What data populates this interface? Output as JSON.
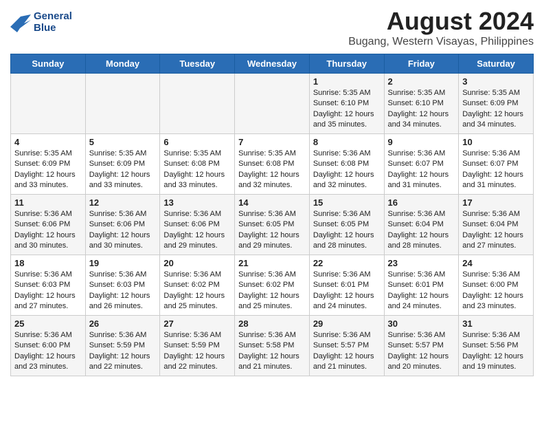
{
  "logo": {
    "line1": "General",
    "line2": "Blue"
  },
  "title": "August 2024",
  "subtitle": "Bugang, Western Visayas, Philippines",
  "days_of_week": [
    "Sunday",
    "Monday",
    "Tuesday",
    "Wednesday",
    "Thursday",
    "Friday",
    "Saturday"
  ],
  "weeks": [
    [
      {
        "day": "",
        "info": ""
      },
      {
        "day": "",
        "info": ""
      },
      {
        "day": "",
        "info": ""
      },
      {
        "day": "",
        "info": ""
      },
      {
        "day": "1",
        "info": "Sunrise: 5:35 AM\nSunset: 6:10 PM\nDaylight: 12 hours\nand 35 minutes."
      },
      {
        "day": "2",
        "info": "Sunrise: 5:35 AM\nSunset: 6:10 PM\nDaylight: 12 hours\nand 34 minutes."
      },
      {
        "day": "3",
        "info": "Sunrise: 5:35 AM\nSunset: 6:09 PM\nDaylight: 12 hours\nand 34 minutes."
      }
    ],
    [
      {
        "day": "4",
        "info": "Sunrise: 5:35 AM\nSunset: 6:09 PM\nDaylight: 12 hours\nand 33 minutes."
      },
      {
        "day": "5",
        "info": "Sunrise: 5:35 AM\nSunset: 6:09 PM\nDaylight: 12 hours\nand 33 minutes."
      },
      {
        "day": "6",
        "info": "Sunrise: 5:35 AM\nSunset: 6:08 PM\nDaylight: 12 hours\nand 33 minutes."
      },
      {
        "day": "7",
        "info": "Sunrise: 5:35 AM\nSunset: 6:08 PM\nDaylight: 12 hours\nand 32 minutes."
      },
      {
        "day": "8",
        "info": "Sunrise: 5:36 AM\nSunset: 6:08 PM\nDaylight: 12 hours\nand 32 minutes."
      },
      {
        "day": "9",
        "info": "Sunrise: 5:36 AM\nSunset: 6:07 PM\nDaylight: 12 hours\nand 31 minutes."
      },
      {
        "day": "10",
        "info": "Sunrise: 5:36 AM\nSunset: 6:07 PM\nDaylight: 12 hours\nand 31 minutes."
      }
    ],
    [
      {
        "day": "11",
        "info": "Sunrise: 5:36 AM\nSunset: 6:06 PM\nDaylight: 12 hours\nand 30 minutes."
      },
      {
        "day": "12",
        "info": "Sunrise: 5:36 AM\nSunset: 6:06 PM\nDaylight: 12 hours\nand 30 minutes."
      },
      {
        "day": "13",
        "info": "Sunrise: 5:36 AM\nSunset: 6:06 PM\nDaylight: 12 hours\nand 29 minutes."
      },
      {
        "day": "14",
        "info": "Sunrise: 5:36 AM\nSunset: 6:05 PM\nDaylight: 12 hours\nand 29 minutes."
      },
      {
        "day": "15",
        "info": "Sunrise: 5:36 AM\nSunset: 6:05 PM\nDaylight: 12 hours\nand 28 minutes."
      },
      {
        "day": "16",
        "info": "Sunrise: 5:36 AM\nSunset: 6:04 PM\nDaylight: 12 hours\nand 28 minutes."
      },
      {
        "day": "17",
        "info": "Sunrise: 5:36 AM\nSunset: 6:04 PM\nDaylight: 12 hours\nand 27 minutes."
      }
    ],
    [
      {
        "day": "18",
        "info": "Sunrise: 5:36 AM\nSunset: 6:03 PM\nDaylight: 12 hours\nand 27 minutes."
      },
      {
        "day": "19",
        "info": "Sunrise: 5:36 AM\nSunset: 6:03 PM\nDaylight: 12 hours\nand 26 minutes."
      },
      {
        "day": "20",
        "info": "Sunrise: 5:36 AM\nSunset: 6:02 PM\nDaylight: 12 hours\nand 25 minutes."
      },
      {
        "day": "21",
        "info": "Sunrise: 5:36 AM\nSunset: 6:02 PM\nDaylight: 12 hours\nand 25 minutes."
      },
      {
        "day": "22",
        "info": "Sunrise: 5:36 AM\nSunset: 6:01 PM\nDaylight: 12 hours\nand 24 minutes."
      },
      {
        "day": "23",
        "info": "Sunrise: 5:36 AM\nSunset: 6:01 PM\nDaylight: 12 hours\nand 24 minutes."
      },
      {
        "day": "24",
        "info": "Sunrise: 5:36 AM\nSunset: 6:00 PM\nDaylight: 12 hours\nand 23 minutes."
      }
    ],
    [
      {
        "day": "25",
        "info": "Sunrise: 5:36 AM\nSunset: 6:00 PM\nDaylight: 12 hours\nand 23 minutes."
      },
      {
        "day": "26",
        "info": "Sunrise: 5:36 AM\nSunset: 5:59 PM\nDaylight: 12 hours\nand 22 minutes."
      },
      {
        "day": "27",
        "info": "Sunrise: 5:36 AM\nSunset: 5:59 PM\nDaylight: 12 hours\nand 22 minutes."
      },
      {
        "day": "28",
        "info": "Sunrise: 5:36 AM\nSunset: 5:58 PM\nDaylight: 12 hours\nand 21 minutes."
      },
      {
        "day": "29",
        "info": "Sunrise: 5:36 AM\nSunset: 5:57 PM\nDaylight: 12 hours\nand 21 minutes."
      },
      {
        "day": "30",
        "info": "Sunrise: 5:36 AM\nSunset: 5:57 PM\nDaylight: 12 hours\nand 20 minutes."
      },
      {
        "day": "31",
        "info": "Sunrise: 5:36 AM\nSunset: 5:56 PM\nDaylight: 12 hours\nand 19 minutes."
      }
    ]
  ]
}
